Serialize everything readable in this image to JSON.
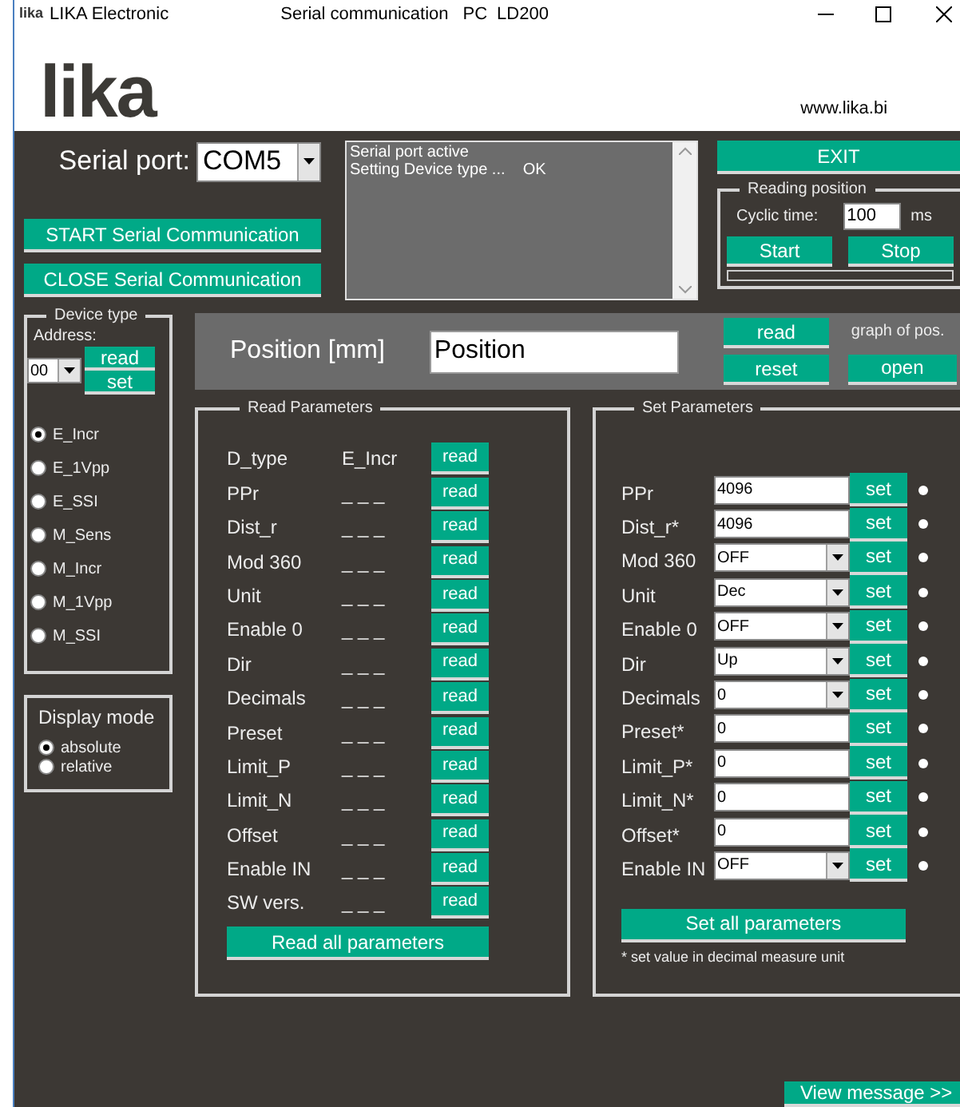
{
  "title_bar": {
    "logo": "lika",
    "app_name": "LIKA Electronic",
    "title_parts": [
      "Serial communication",
      "PC",
      "LD200"
    ]
  },
  "header": {
    "logo": "lika",
    "website": "www.lika.bi"
  },
  "serial_port": {
    "label": "Serial port:",
    "value": "COM5"
  },
  "connection_buttons": [
    "START Serial Communication",
    "CLOSE Serial Communication"
  ],
  "message_log": [
    "Serial port active",
    "Setting Device type ...    OK"
  ],
  "exit_button": "EXIT",
  "reading_position": {
    "title": "Reading position",
    "cyclic_label": "Cyclic time:",
    "cyclic_value": "100",
    "unit": "ms",
    "start": "Start",
    "stop": "Stop",
    "level": 0
  },
  "device_type": {
    "title": "Device type",
    "address_label": "Address:",
    "address": "00",
    "read": "read",
    "set": "set",
    "options": [
      {
        "label": "E_Incr",
        "selected": true
      },
      {
        "label": "E_1Vpp",
        "selected": false
      },
      {
        "label": "E_SSI",
        "selected": false
      },
      {
        "label": "M_Sens",
        "selected": false
      },
      {
        "label": "M_Incr",
        "selected": false
      },
      {
        "label": "M_1Vpp",
        "selected": false
      },
      {
        "label": "M_SSI",
        "selected": false
      }
    ]
  },
  "display_mode": {
    "title": "Display mode",
    "options": [
      {
        "label": "absolute",
        "selected": true
      },
      {
        "label": "relative",
        "selected": false
      }
    ]
  },
  "position": {
    "label": "Position [mm]",
    "value": "Position",
    "read": "read",
    "reset": "reset",
    "graph_label": "graph of pos.",
    "open": "open"
  },
  "read_parameters": {
    "title": "Read Parameters",
    "rows": [
      {
        "name": "D_type",
        "value": "E_Incr",
        "button": "read"
      },
      {
        "name": "PPr",
        "value": "_ _ _",
        "button": "read"
      },
      {
        "name": "Dist_r",
        "value": "_ _ _",
        "button": "read"
      },
      {
        "name": "Mod 360",
        "value": "_ _ _",
        "button": "read"
      },
      {
        "name": "Unit",
        "value": "_ _ _",
        "button": "read"
      },
      {
        "name": "Enable 0",
        "value": "_ _ _",
        "button": "read"
      },
      {
        "name": "Dir",
        "value": "_ _ _",
        "button": "read"
      },
      {
        "name": "Decimals",
        "value": "_ _ _",
        "button": "read"
      },
      {
        "name": "Preset",
        "value": "_ _ _",
        "button": "read"
      },
      {
        "name": "Limit_P",
        "value": "_ _ _",
        "button": "read"
      },
      {
        "name": "Limit_N",
        "value": "_ _ _",
        "button": "read"
      },
      {
        "name": "Offset",
        "value": "_ _ _",
        "button": "read"
      },
      {
        "name": "Enable IN",
        "value": "_ _ _",
        "button": "read"
      },
      {
        "name": "SW vers.",
        "value": "_ _ _",
        "button": "read"
      }
    ],
    "read_all": "Read all parameters"
  },
  "set_parameters": {
    "title": "Set Parameters",
    "rows": [
      {
        "name": "PPr",
        "kind": "text",
        "value": "4096",
        "button": "set"
      },
      {
        "name": "Dist_r*",
        "kind": "text",
        "value": "4096",
        "button": "set"
      },
      {
        "name": "Mod 360",
        "kind": "select",
        "value": "OFF",
        "button": "set"
      },
      {
        "name": "Unit",
        "kind": "select",
        "value": "Dec",
        "button": "set"
      },
      {
        "name": "Enable 0",
        "kind": "select",
        "value": "OFF",
        "button": "set"
      },
      {
        "name": "Dir",
        "kind": "select",
        "value": "Up",
        "button": "set"
      },
      {
        "name": "Decimals",
        "kind": "select",
        "value": "0",
        "button": "set"
      },
      {
        "name": "Preset*",
        "kind": "text",
        "value": "0",
        "button": "set"
      },
      {
        "name": "Limit_P*",
        "kind": "text",
        "value": "0",
        "button": "set"
      },
      {
        "name": "Limit_N*",
        "kind": "text",
        "value": "0",
        "button": "set"
      },
      {
        "name": "Offset*",
        "kind": "text",
        "value": "0",
        "button": "set"
      },
      {
        "name": "Enable IN",
        "kind": "select",
        "value": "OFF",
        "button": "set"
      }
    ],
    "set_all": "Set all parameters",
    "note": "* set value in decimal measure unit"
  },
  "view_message_button": "View message >>"
}
